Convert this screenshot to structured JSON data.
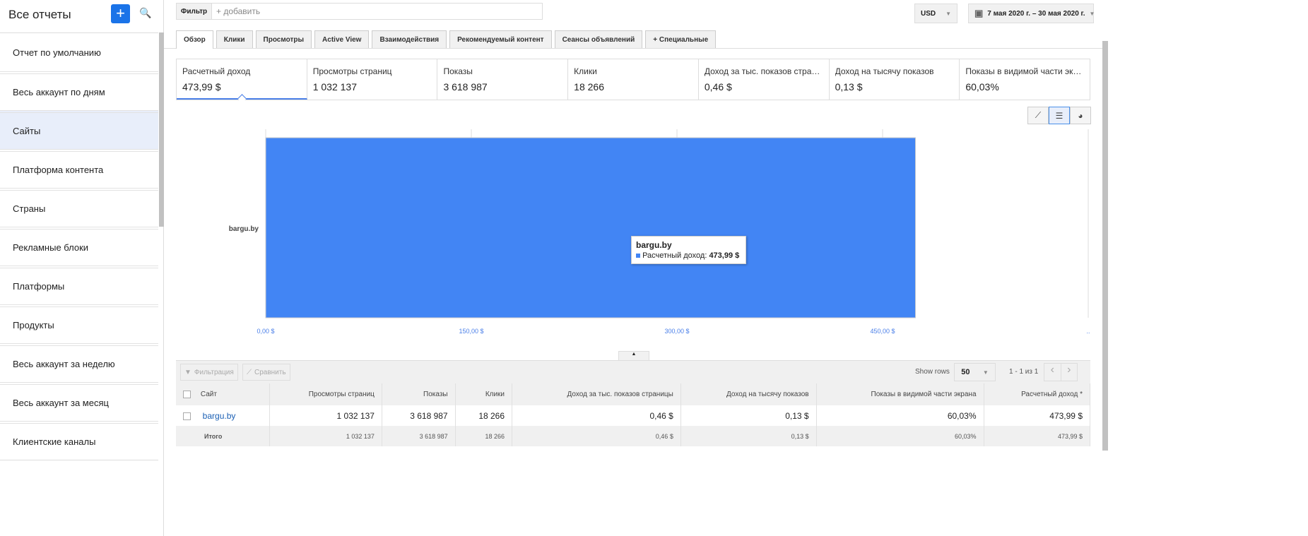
{
  "sidebar": {
    "title": "Все отчеты",
    "items": [
      "Отчет по умолчанию",
      "Весь аккаунт по дням",
      "Сайты",
      "Платформа контента",
      "Страны",
      "Рекламные блоки",
      "Платформы",
      "Продукты",
      "Весь аккаунт за неделю",
      "Весь аккаунт за месяц",
      "Клиентские каналы"
    ],
    "active": 2
  },
  "filter": {
    "label": "Фильтр",
    "placeholder": "+ добавить"
  },
  "currency": "USD",
  "date_range": "7 мая 2020 г. – 30 мая 2020 г.",
  "tabs": [
    "Обзор",
    "Клики",
    "Просмотры",
    "Active View",
    "Взаимодействия",
    "Рекомендуемый контент",
    "Сеансы объявлений",
    "+  Специальные"
  ],
  "kpis": [
    {
      "title": "Расчетный доход",
      "value": "473,99 $"
    },
    {
      "title": "Просмотры страниц",
      "value": "1 032 137"
    },
    {
      "title": "Показы",
      "value": "3 618 987"
    },
    {
      "title": "Клики",
      "value": "18 266"
    },
    {
      "title": "Доход за тыс. показов страни...",
      "value": "0,46 $"
    },
    {
      "title": "Доход на тысячу показов",
      "value": "0,13 $"
    },
    {
      "title": "Показы в видимой части экрана",
      "value": "60,03%"
    }
  ],
  "chart_data": {
    "type": "bar",
    "orientation": "horizontal",
    "categories": [
      "bargu.by"
    ],
    "values": [
      473.99
    ],
    "series_name": "Расчетный доход",
    "xlim": [
      0,
      600
    ],
    "xticks": [
      0,
      150,
      300,
      450
    ],
    "xtick_labels": [
      "0,00 $",
      "150,00 $",
      "300,00 $",
      "450,00 $",
      ".."
    ],
    "color": "#4285f4"
  },
  "tooltip": {
    "title": "bargu.by",
    "label": "Расчетный доход:",
    "value": "473,99 $"
  },
  "table_toolbar": {
    "filter": "Фильтрация",
    "compare": "Сравнить",
    "show_rows": "Show rows",
    "rows": "50",
    "pagination": "1 - 1 из 1"
  },
  "table": {
    "headers": [
      "Сайт",
      "Просмотры страниц",
      "Показы",
      "Клики",
      "Доход за тыс. показов страницы",
      "Доход на тысячу показов",
      "Показы в видимой части экрана",
      "Расчетный доход *"
    ],
    "rows": [
      [
        "bargu.by",
        "1 032 137",
        "3 618 987",
        "18 266",
        "0,46 $",
        "0,13 $",
        "60,03%",
        "473,99 $"
      ]
    ],
    "total": [
      "Итого",
      "1 032 137",
      "3 618 987",
      "18 266",
      "0,46 $",
      "0,13 $",
      "60,03%",
      "473,99 $"
    ]
  }
}
